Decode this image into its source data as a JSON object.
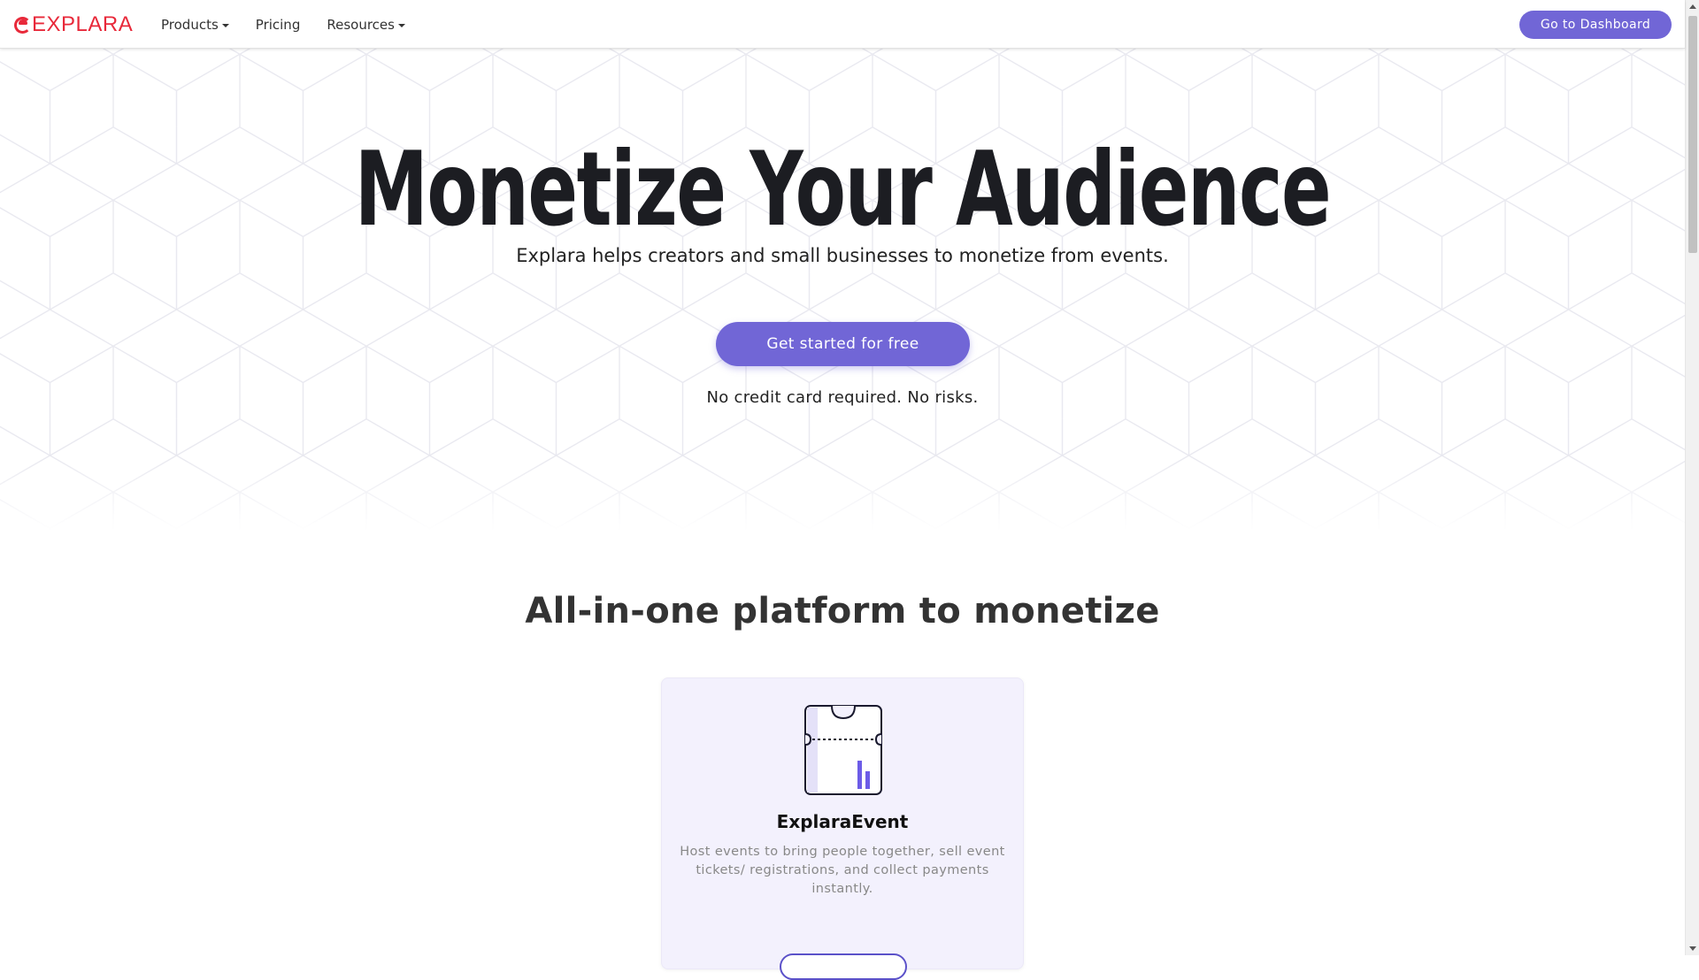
{
  "navbar": {
    "logo_text": "EXPLARA",
    "items": [
      {
        "label": "Products",
        "has_dropdown": true
      },
      {
        "label": "Pricing",
        "has_dropdown": false
      },
      {
        "label": "Resources",
        "has_dropdown": true
      }
    ],
    "dashboard_button": "Go to Dashboard"
  },
  "hero": {
    "title": "Monetize Your Audience",
    "subtitle": "Explara helps creators and small businesses to monetize from events.",
    "cta_label": "Get started for free",
    "note": "No credit card required. No risks."
  },
  "platform": {
    "title": "All-in-one platform to monetize",
    "card": {
      "icon": "ticket-icon",
      "title": "ExplaraEvent",
      "description": "Host events to bring people together, sell event tickets/ registrations, and collect payments instantly."
    }
  },
  "colors": {
    "brand_red": "#e8293a",
    "accent_purple": "#7166d6",
    "card_bg": "#f3f1fd"
  }
}
